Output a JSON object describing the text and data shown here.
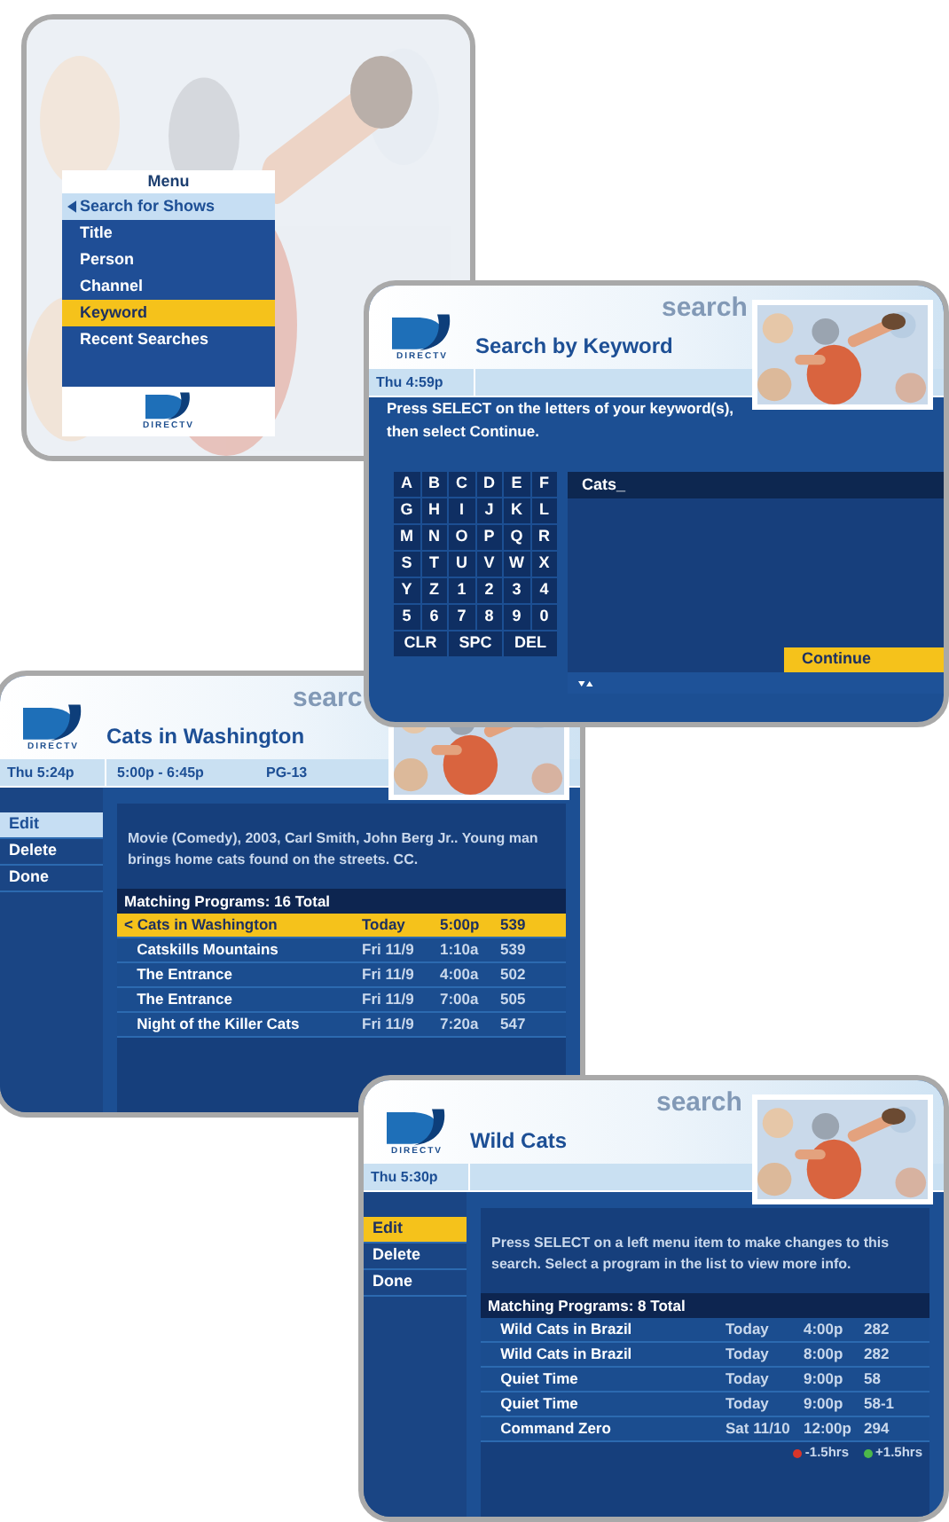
{
  "menu_screen": {
    "menu_title": "Menu",
    "logo_text": "DIRECTV",
    "items": [
      {
        "label": "Search for Shows",
        "open": true,
        "selected": false
      },
      {
        "label": "Title",
        "open": false,
        "selected": false
      },
      {
        "label": "Person",
        "open": false,
        "selected": false
      },
      {
        "label": "Channel",
        "open": false,
        "selected": false
      },
      {
        "label": "Keyword",
        "open": false,
        "selected": true
      },
      {
        "label": "Recent Searches",
        "open": false,
        "selected": false
      }
    ]
  },
  "keyword_screen": {
    "logo_text": "DIRECTV",
    "section": "search",
    "title": "Search by Keyword",
    "time": "Thu 4:59p",
    "instructions": "Press SELECT on the letters of your keyword(s), then select Continue.",
    "key_rows": [
      [
        {
          "label": "A",
          "selected": false
        },
        {
          "label": "B",
          "selected": false
        },
        {
          "label": "C",
          "selected": false
        },
        {
          "label": "D",
          "selected": false
        },
        {
          "label": "E",
          "selected": false
        },
        {
          "label": "F",
          "selected": false
        }
      ],
      [
        {
          "label": "G",
          "selected": false
        },
        {
          "label": "H",
          "selected": false
        },
        {
          "label": "I",
          "selected": false
        },
        {
          "label": "J",
          "selected": false
        },
        {
          "label": "K",
          "selected": false
        },
        {
          "label": "L",
          "selected": false
        }
      ],
      [
        {
          "label": "M",
          "selected": false
        },
        {
          "label": "N",
          "selected": false
        },
        {
          "label": "O",
          "selected": false
        },
        {
          "label": "P",
          "selected": false
        },
        {
          "label": "Q",
          "selected": false
        },
        {
          "label": "R",
          "selected": false
        }
      ],
      [
        {
          "label": "S",
          "selected": false
        },
        {
          "label": "T",
          "selected": false
        },
        {
          "label": "U",
          "selected": false
        },
        {
          "label": "V",
          "selected": false
        },
        {
          "label": "W",
          "selected": false
        },
        {
          "label": "X",
          "selected": false
        }
      ],
      [
        {
          "label": "Y",
          "selected": false
        },
        {
          "label": "Z",
          "selected": false
        },
        {
          "label": "1",
          "selected": false
        },
        {
          "label": "2",
          "selected": false
        },
        {
          "label": "3",
          "selected": false
        },
        {
          "label": "4",
          "selected": false
        }
      ],
      [
        {
          "label": "5",
          "selected": false
        },
        {
          "label": "6",
          "selected": false
        },
        {
          "label": "7",
          "selected": false
        },
        {
          "label": "8",
          "selected": false
        },
        {
          "label": "9",
          "selected": false
        },
        {
          "label": "0",
          "selected": false
        }
      ],
      [
        {
          "label": "CLR",
          "selected": false
        },
        {
          "label": "SPC",
          "selected": false
        },
        {
          "label": "DEL",
          "selected": false
        }
      ]
    ],
    "entry": "Cats_",
    "continue": {
      "label": "Continue",
      "selected": true
    }
  },
  "details_screen": {
    "logo_text": "DIRECTV",
    "section": "searc",
    "title": "Cats in Washington",
    "time": "Thu 5:24p",
    "airtime": "5:00p - 6:45p",
    "rating": "PG-13",
    "menu_focused": false,
    "menu": [
      {
        "label": "Edit",
        "selected": true
      },
      {
        "label": "Delete",
        "selected": false
      },
      {
        "label": "Done",
        "selected": false
      }
    ],
    "description": "Movie (Comedy), 2003, Carl Smith, John Berg Jr.. Young man brings home cats found on the streets. CC.",
    "list_title": "Matching Programs: 16 Total",
    "rows": [
      {
        "marker": "<",
        "title": "Cats in Washington",
        "day": "Today",
        "time": "5:00p",
        "channel": "539",
        "selected": true
      },
      {
        "title": "Catskills Mountains",
        "day": "Fri 11/9",
        "time": "1:10a",
        "channel": "539",
        "selected": false
      },
      {
        "title": "The Entrance",
        "day": "Fri 11/9",
        "time": "4:00a",
        "channel": "502",
        "selected": false
      },
      {
        "title": "The Entrance",
        "day": "Fri 11/9",
        "time": "7:00a",
        "channel": "505",
        "selected": false
      },
      {
        "title": "Night of the Killer Cats",
        "day": "Fri 11/9",
        "time": "7:20a",
        "channel": "547",
        "selected": false
      }
    ]
  },
  "results_screen": {
    "logo_text": "DIRECTV",
    "section": "search",
    "title": "Wild Cats",
    "time": "Thu 5:30p",
    "menu_focused": true,
    "menu": [
      {
        "label": "Edit",
        "selected": true
      },
      {
        "label": "Delete",
        "selected": false
      },
      {
        "label": "Done",
        "selected": false
      }
    ],
    "description": "Press SELECT on a left menu item to make changes to this search. Select a program in the list to view more info.",
    "list_title": "Matching Programs: 8 Total",
    "rows": [
      {
        "title": "Wild Cats in Brazil",
        "day": "Today",
        "time": "4:00p",
        "channel": "282",
        "selected": false
      },
      {
        "title": "Wild Cats in Brazil",
        "day": "Today",
        "time": "8:00p",
        "channel": "282",
        "selected": false
      },
      {
        "title": "Quiet Time",
        "day": "Today",
        "time": "9:00p",
        "channel": "58",
        "selected": false
      },
      {
        "title": "Quiet Time",
        "day": "Today",
        "time": "9:00p",
        "channel": "58-1",
        "selected": false
      },
      {
        "title": "Command Zero",
        "day": "Sat 11/10",
        "time": "12:00p",
        "channel": "294",
        "selected": false
      }
    ],
    "legend": [
      {
        "label": "-1.5hrs",
        "color": "#d8352a"
      },
      {
        "label": "+1.5hrs",
        "color": "#4cb84a"
      }
    ]
  }
}
